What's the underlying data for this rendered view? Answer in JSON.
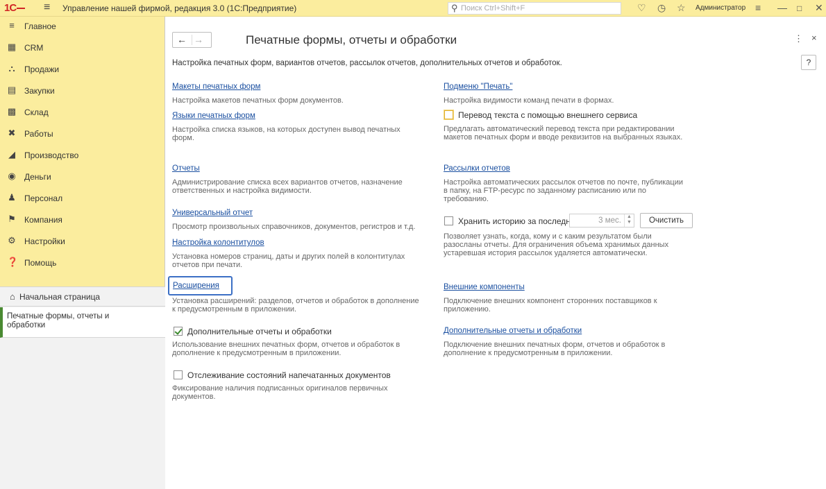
{
  "titlebar": {
    "logo": "1С",
    "title": "Управление нашей фирмой, редакция 3.0  (1С:Предприятие)",
    "search_placeholder": "Поиск Ctrl+Shift+F",
    "user": "Администратор"
  },
  "sidebar": {
    "items": [
      {
        "label": "Главное",
        "icon": "list-icon"
      },
      {
        "label": "CRM",
        "icon": "crm-icon"
      },
      {
        "label": "Продажи",
        "icon": "shop-icon"
      },
      {
        "label": "Закупки",
        "icon": "purchase-icon"
      },
      {
        "label": "Склад",
        "icon": "warehouse-icon"
      },
      {
        "label": "Работы",
        "icon": "tools-icon"
      },
      {
        "label": "Производство",
        "icon": "factory-icon"
      },
      {
        "label": "Деньги",
        "icon": "money-icon"
      },
      {
        "label": "Персонал",
        "icon": "people-icon"
      },
      {
        "label": "Компания",
        "icon": "flag-icon"
      },
      {
        "label": "Настройки",
        "icon": "gear-icon"
      },
      {
        "label": "Помощь",
        "icon": "help-icon"
      }
    ],
    "home": "Начальная страница",
    "active": "Печатные формы, отчеты и обработки"
  },
  "main": {
    "title": "Печатные формы, отчеты и обработки",
    "subtitle": "Настройка печатных форм, вариантов отчетов, рассылок отчетов, дополнительных отчетов и обработок.",
    "help": "?",
    "left": {
      "templates_link": "Макеты печатных форм",
      "templates_desc": "Настройка макетов печатных форм документов.",
      "languages_link": "Языки печатных форм",
      "languages_desc": "Настройка списка языков, на которых доступен вывод печатных форм.",
      "reports_link": "Отчеты",
      "reports_desc": "Администрирование списка всех вариантов отчетов, назначение ответственных и настройка видимости.",
      "universal_link": "Универсальный отчет",
      "universal_desc": "Просмотр произвольных справочников, документов, регистров и т.д.",
      "headers_link": "Настройка колонтитулов",
      "headers_desc": "Установка номеров страниц, даты и других полей в колонтитулах отчетов при печати.",
      "extensions_link": "Расширения",
      "extensions_desc": "Установка расширений: разделов, отчетов и обработок в дополнение к предусмотренным в приложении.",
      "addl_check_label": "Дополнительные отчеты и обработки",
      "addl_check_desc": "Использование внешних печатных форм, отчетов и обработок в дополнение к предусмотренным в приложении.",
      "tracking_label": "Отслеживание состояний напечатанных документов",
      "tracking_desc": "Фиксирование наличия подписанных оригиналов первичных документов."
    },
    "right": {
      "print_menu_link": "Подменю \"Печать\"",
      "print_menu_desc": "Настройка видимости команд печати в формах.",
      "translate_label": "Перевод текста с помощью внешнего сервиса",
      "translate_desc": "Предлагать автоматический перевод текста при редактировании макетов печатных форм и вводе реквизитов на выбранных языках.",
      "mailing_link": "Рассылки отчетов",
      "mailing_desc": "Настройка автоматических рассылок отчетов по почте, публикации в папку, на FTP-ресурс по заданному расписанию или по требованию.",
      "history_label": "Хранить историю за последние",
      "history_value": "3 мес.",
      "clear_button": "Очистить",
      "history_desc": "Позволяет узнать, когда, кому и с каким результатом были разосланы отчеты. Для ограничения объема хранимых данных устаревшая история рассылок удаляется автоматически.",
      "components_link": "Внешние компоненты",
      "components_desc": "Подключение внешних компонент сторонних поставщиков к приложению.",
      "addl_link": "Дополнительные отчеты и обработки",
      "addl_desc": "Подключение внешних печатных форм, отчетов и обработок в дополнение к предусмотренным в приложении."
    }
  }
}
